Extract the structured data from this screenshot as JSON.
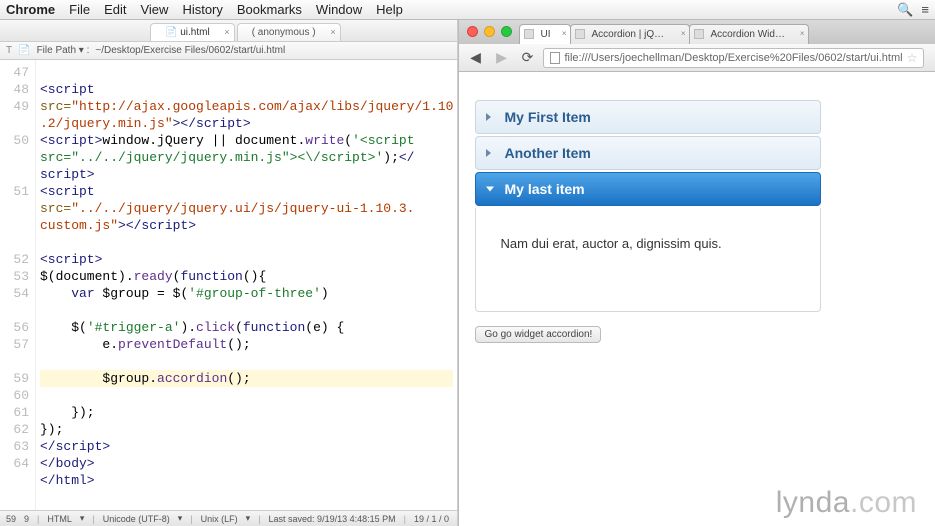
{
  "menubar": {
    "app": "Chrome",
    "items": [
      "File",
      "Edit",
      "View",
      "History",
      "Bookmarks",
      "Window",
      "Help"
    ]
  },
  "editor": {
    "tabs": [
      {
        "label": "ui.html",
        "active": true
      },
      {
        "label": "( anonymous )",
        "active": false
      }
    ],
    "filepath_label": "File Path ▾ :",
    "filepath": "~/Desktop/Exercise Files/0602/start/ui.html",
    "line_start": 47,
    "lines": [
      "<script",
      "src=\"http://ajax.googleapis.com/ajax/libs/jquery/1.10.2/jquery.min.js\"></script>",
      "<script>window.jQuery || document.write('<script src=\"../../jquery/jquery.min.js\"><\\/script>');<//script>",
      "<script",
      "src=\"../../jquery/jquery.ui/js/jquery-ui-1.10.3.custom.js\"></script>",
      "",
      "<script>",
      "$(document).ready(function(){",
      "    var $group = $('#group-of-three')",
      "",
      "    $('#trigger-a').click(function(e) {",
      "        e.preventDefault();",
      "",
      "        $group.accordion();",
      "    });",
      "});",
      "</script>",
      "</body>",
      "</html>"
    ],
    "statusbar": {
      "line": "59",
      "col": "9",
      "lang": "HTML",
      "encoding": "Unicode (UTF-8)",
      "lineend": "Unix (LF)",
      "saved": "Last saved: 9/19/13 4:48:15 PM",
      "pos": "19 / 1 / 0"
    }
  },
  "browser": {
    "tabs": [
      {
        "label": "UI",
        "active": true
      },
      {
        "label": "Accordion | jQuery UI",
        "active": false
      },
      {
        "label": "Accordion Widget | jQ…",
        "active": false
      }
    ],
    "url": "file:///Users/joechellman/Desktop/Exercise%20Files/0602/start/ui.html",
    "accordion": {
      "items": [
        {
          "title": "My First Item",
          "active": false
        },
        {
          "title": "Another Item",
          "active": false
        },
        {
          "title": "My last item",
          "active": true,
          "content": "Nam dui erat, auctor a, dignissim quis."
        }
      ]
    },
    "trigger_label": "Go go widget accordion!"
  },
  "watermark": {
    "brand": "lynda",
    "suffix": ".com"
  }
}
